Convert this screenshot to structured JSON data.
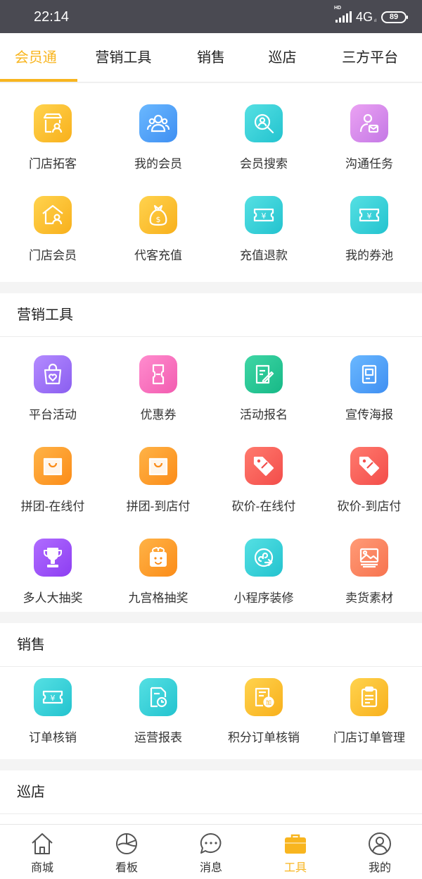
{
  "status_bar": {
    "time": "22:14",
    "hd": "HD",
    "network": "4G",
    "battery": "89"
  },
  "tabs": [
    {
      "label": "会员通",
      "active": true
    },
    {
      "label": "营销工具"
    },
    {
      "label": "销售"
    },
    {
      "label": "巡店"
    },
    {
      "label": "三方平台"
    }
  ],
  "member_section": {
    "items": [
      {
        "label": "门店拓客",
        "icon": "store-customer-icon"
      },
      {
        "label": "我的会员",
        "icon": "members-icon"
      },
      {
        "label": "会员搜索",
        "icon": "member-search-icon"
      },
      {
        "label": "沟通任务",
        "icon": "communication-task-icon"
      },
      {
        "label": "门店会员",
        "icon": "store-member-icon"
      },
      {
        "label": "代客充值",
        "icon": "money-bag-icon"
      },
      {
        "label": "充值退款",
        "icon": "yen-ticket-icon"
      },
      {
        "label": "我的券池",
        "icon": "coupon-pool-icon"
      }
    ]
  },
  "marketing_section": {
    "title": "营销工具",
    "items": [
      {
        "label": "平台活动",
        "icon": "shopping-bag-heart-icon"
      },
      {
        "label": "优惠券",
        "icon": "coupon-icon"
      },
      {
        "label": "活动报名",
        "icon": "sign-up-icon"
      },
      {
        "label": "宣传海报",
        "icon": "poster-icon"
      },
      {
        "label": "拼团-在线付",
        "icon": "group-buy-bag-icon"
      },
      {
        "label": "拼团-到店付",
        "icon": "group-buy-bag-icon"
      },
      {
        "label": "砍价-在线付",
        "icon": "price-tag-icon"
      },
      {
        "label": "砍价-到店付",
        "icon": "price-tag-icon"
      },
      {
        "label": "多人大抽奖",
        "icon": "trophy-icon"
      },
      {
        "label": "九宫格抽奖",
        "icon": "gift-icon"
      },
      {
        "label": "小程序装修",
        "icon": "mini-program-icon"
      },
      {
        "label": "卖货素材",
        "icon": "image-material-icon"
      }
    ]
  },
  "sales_section": {
    "title": "销售",
    "items": [
      {
        "label": "订单核销",
        "icon": "yen-ticket-icon"
      },
      {
        "label": "运营报表",
        "icon": "report-clock-icon"
      },
      {
        "label": "积分订单核销",
        "icon": "points-order-icon"
      },
      {
        "label": "门店订单管理",
        "icon": "clipboard-icon"
      }
    ]
  },
  "patrol_section": {
    "title": "巡店"
  },
  "bottom_nav": [
    {
      "label": "商城",
      "icon": "home-icon"
    },
    {
      "label": "看板",
      "icon": "dashboard-icon"
    },
    {
      "label": "消息",
      "icon": "message-icon"
    },
    {
      "label": "工具",
      "icon": "toolbox-icon",
      "active": true
    },
    {
      "label": "我的",
      "icon": "profile-icon"
    }
  ],
  "colors": {
    "accent": "#f8b51f",
    "text": "#333333",
    "background": "#f4f4f4"
  }
}
